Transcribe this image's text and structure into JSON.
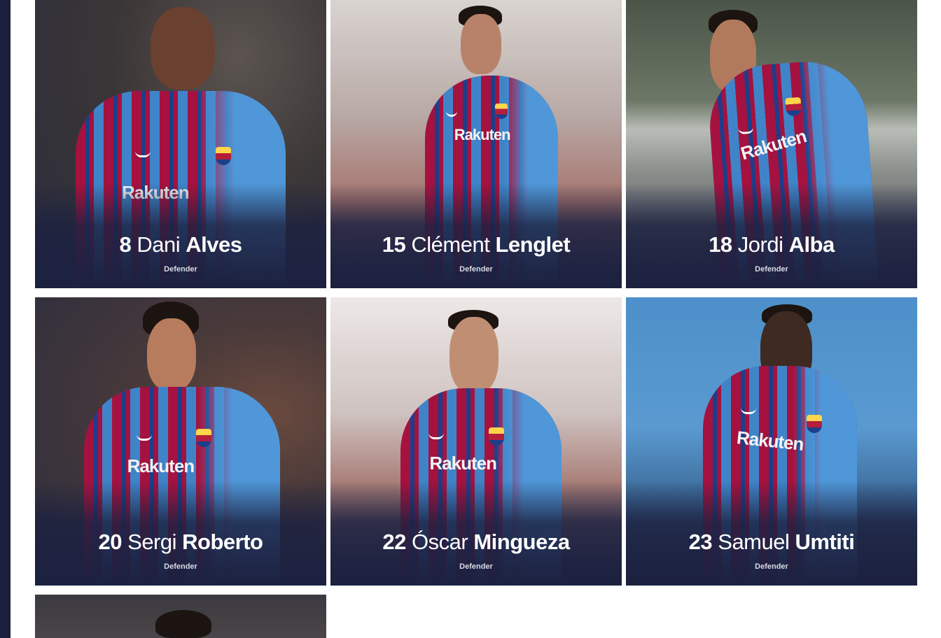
{
  "players": [
    {
      "number": "8",
      "first": "Dani",
      "last": "Alves",
      "position": "Defender"
    },
    {
      "number": "15",
      "first": "Clément",
      "last": "Lenglet",
      "position": "Defender"
    },
    {
      "number": "18",
      "first": "Jordi",
      "last": "Alba",
      "position": "Defender"
    },
    {
      "number": "20",
      "first": "Sergi",
      "last": "Roberto",
      "position": "Defender"
    },
    {
      "number": "22",
      "first": "Óscar",
      "last": "Mingueza",
      "position": "Defender"
    },
    {
      "number": "23",
      "first": "Samuel",
      "last": "Umtiti",
      "position": "Defender"
    }
  ],
  "shirt_sponsor": "Rakuten",
  "colors": {
    "sidebar": "#1a1f3d",
    "caption_overlay": "#1c2140",
    "shirt_garnet": "#a5123f",
    "shirt_blue": "#3f84c9"
  }
}
